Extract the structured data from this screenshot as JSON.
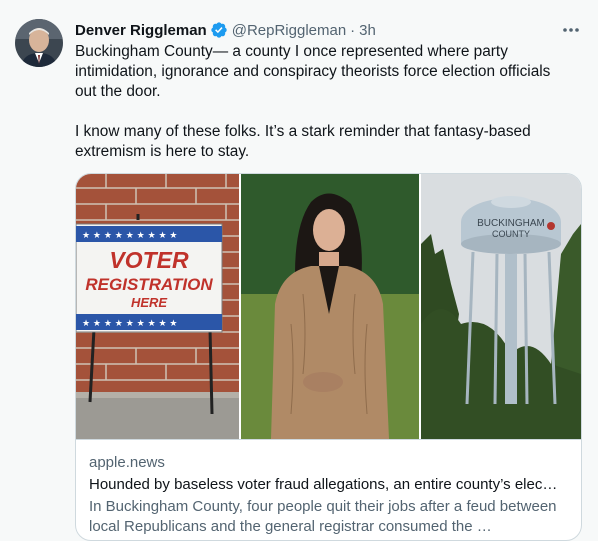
{
  "tweet": {
    "author_name": "Denver Riggleman",
    "handle": "@RepRiggleman",
    "separator": "·",
    "time": "3h",
    "verified_icon": "verified-badge-icon",
    "more_icon": "more-horizontal-icon",
    "paragraphs": [
      "Buckingham County— a county I once  represented where party intimidation, ignorance and conspiracy theorists force election officials out the door.",
      "I know many of these folks. It’s a stark reminder that fantasy-based extremism is here to stay."
    ]
  },
  "card": {
    "images": {
      "left": {
        "sign_line1": "VOTER",
        "sign_line2": "REGISTRATION",
        "sign_line3": "HERE"
      },
      "center": "portrait-photo",
      "right": {
        "tower_line1": "BUCKINGHAM",
        "tower_line2": "COUNTY"
      }
    },
    "domain": "apple.news",
    "title": "Hounded by baseless voter fraud allegations, an entire county’s elec…",
    "description": "In Buckingham County, four people quit their jobs after a feud between local Republicans and the general registrar consumed the …"
  },
  "colors": {
    "background": "#f7f9f9",
    "text_primary": "#0f1419",
    "text_secondary": "#536471",
    "verified_blue": "#1d9bf0",
    "card_border": "#cfd9de"
  }
}
